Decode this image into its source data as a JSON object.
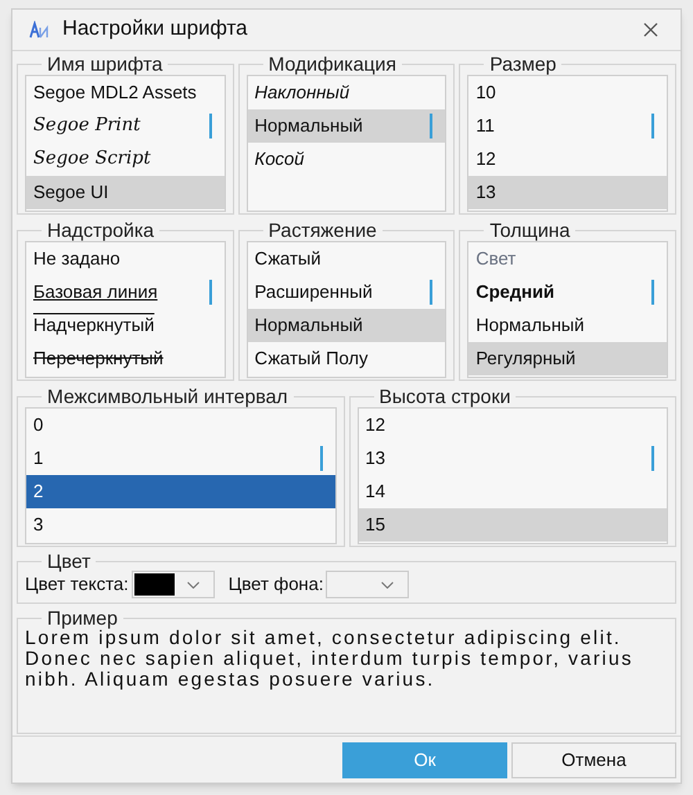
{
  "window": {
    "title": "Настройки шрифта"
  },
  "groups": [
    {
      "title": "Имя шрифта",
      "items": [
        {
          "label": "Segoe MDL2 Assets",
          "kind": "normal",
          "selected": false
        },
        {
          "label": "Segoe Print",
          "kind": "script",
          "selected": false
        },
        {
          "label": "Segoe Script",
          "kind": "script",
          "selected": false
        },
        {
          "label": "Segoe UI",
          "kind": "normal",
          "selected": true
        }
      ]
    },
    {
      "title": "Модификация",
      "items": [
        {
          "label": "Наклонный",
          "kind": "italic",
          "selected": false
        },
        {
          "label": "Нормальный",
          "kind": "normal",
          "selected": true
        },
        {
          "label": "Косой",
          "kind": "italic",
          "selected": false
        }
      ]
    },
    {
      "title": "Размер",
      "items": [
        {
          "label": "10",
          "kind": "normal",
          "selected": false
        },
        {
          "label": "11",
          "kind": "normal",
          "selected": false
        },
        {
          "label": "12",
          "kind": "normal",
          "selected": false
        },
        {
          "label": "13",
          "kind": "normal",
          "selected": true
        }
      ]
    },
    {
      "title": "Надстройка",
      "items": [
        {
          "label": "Не задано",
          "kind": "normal",
          "selected": false
        },
        {
          "label": "Базовая линия",
          "kind": "underline",
          "selected": false
        },
        {
          "label": "Надчеркнутый",
          "kind": "overline",
          "selected": false
        },
        {
          "label": "Перечеркнутый",
          "kind": "strike",
          "selected": false
        }
      ]
    },
    {
      "title": "Растяжение",
      "items": [
        {
          "label": "Сжатый",
          "kind": "small",
          "selected": false
        },
        {
          "label": "Расширенный",
          "kind": "small",
          "selected": false
        },
        {
          "label": "Нормальный",
          "kind": "normal",
          "selected": true
        },
        {
          "label": "Сжатый Полу",
          "kind": "small",
          "selected": false
        }
      ]
    },
    {
      "title": "Толщина",
      "items": [
        {
          "label": "Свет",
          "kind": "light",
          "selected": false
        },
        {
          "label": "Средний",
          "kind": "bold",
          "selected": false
        },
        {
          "label": "Нормальный",
          "kind": "normal",
          "selected": false
        },
        {
          "label": "Регулярный",
          "kind": "normal",
          "selected": true
        }
      ]
    },
    {
      "title": "Межсимвольный интервал",
      "items": [
        {
          "label": "0",
          "kind": "normal",
          "selected": false
        },
        {
          "label": "1",
          "kind": "normal",
          "selected": false
        },
        {
          "label": "2",
          "kind": "normal",
          "selected": true
        },
        {
          "label": "3",
          "kind": "normal",
          "selected": false
        }
      ]
    },
    {
      "title": "Высота строки",
      "items": [
        {
          "label": "12",
          "kind": "normal",
          "selected": false
        },
        {
          "label": "13",
          "kind": "normal",
          "selected": false
        },
        {
          "label": "14",
          "kind": "normal",
          "selected": false
        },
        {
          "label": "15",
          "kind": "normal",
          "selected": true
        }
      ]
    }
  ],
  "color": {
    "title": "Цвет",
    "text_color": {
      "label": "Цвет текста:",
      "color": "#000000"
    },
    "background_label": "Цвет фона:"
  },
  "sample": {
    "title": "Пример",
    "text": "Lorem ipsum dolor sit amet, consectetur adipiscing elit. Donec nec sapien aliquet, interdum turpis tempor, varius nibh. Aliquam egestas posuere varius."
  },
  "buttons": [
    {
      "label": "Ок",
      "kind": "primary"
    },
    {
      "label": "Отмена",
      "kind": "secondary"
    }
  ]
}
